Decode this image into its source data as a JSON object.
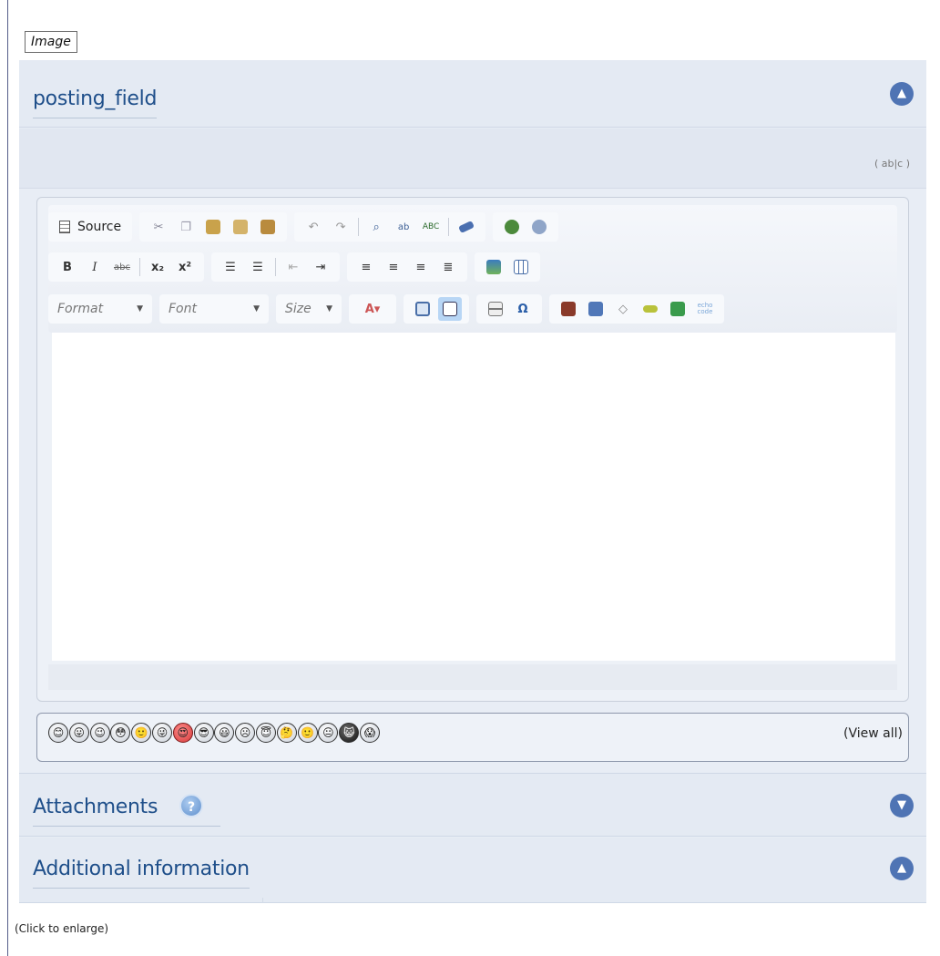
{
  "image_label": "Image",
  "posting_section": {
    "title": "posting_field",
    "toggle": "▲"
  },
  "abc_indicator": "( ab|c )",
  "toolbar": {
    "source_label": "Source",
    "format_placeholder": "Format",
    "font_placeholder": "Font",
    "size_placeholder": "Size",
    "bold": "B",
    "italic": "I",
    "strike": "abc",
    "subscript": "x₂",
    "superscript": "x²",
    "omega": "Ω",
    "echo_code": "echo code"
  },
  "smileys": [
    "😊",
    "😛",
    "😉",
    "😳",
    "🙂",
    "😜",
    "😍",
    "😎",
    "😃",
    "☹",
    "😇",
    "🤔",
    "🙂",
    "😐",
    "😺",
    "😱"
  ],
  "view_all_label": "(View all)",
  "attachments_section": {
    "title": "Attachments",
    "help": "?",
    "toggle": "▼"
  },
  "additional_section": {
    "title": "Additional information",
    "toggle": "▲"
  },
  "caption": "(Click to enlarge)"
}
